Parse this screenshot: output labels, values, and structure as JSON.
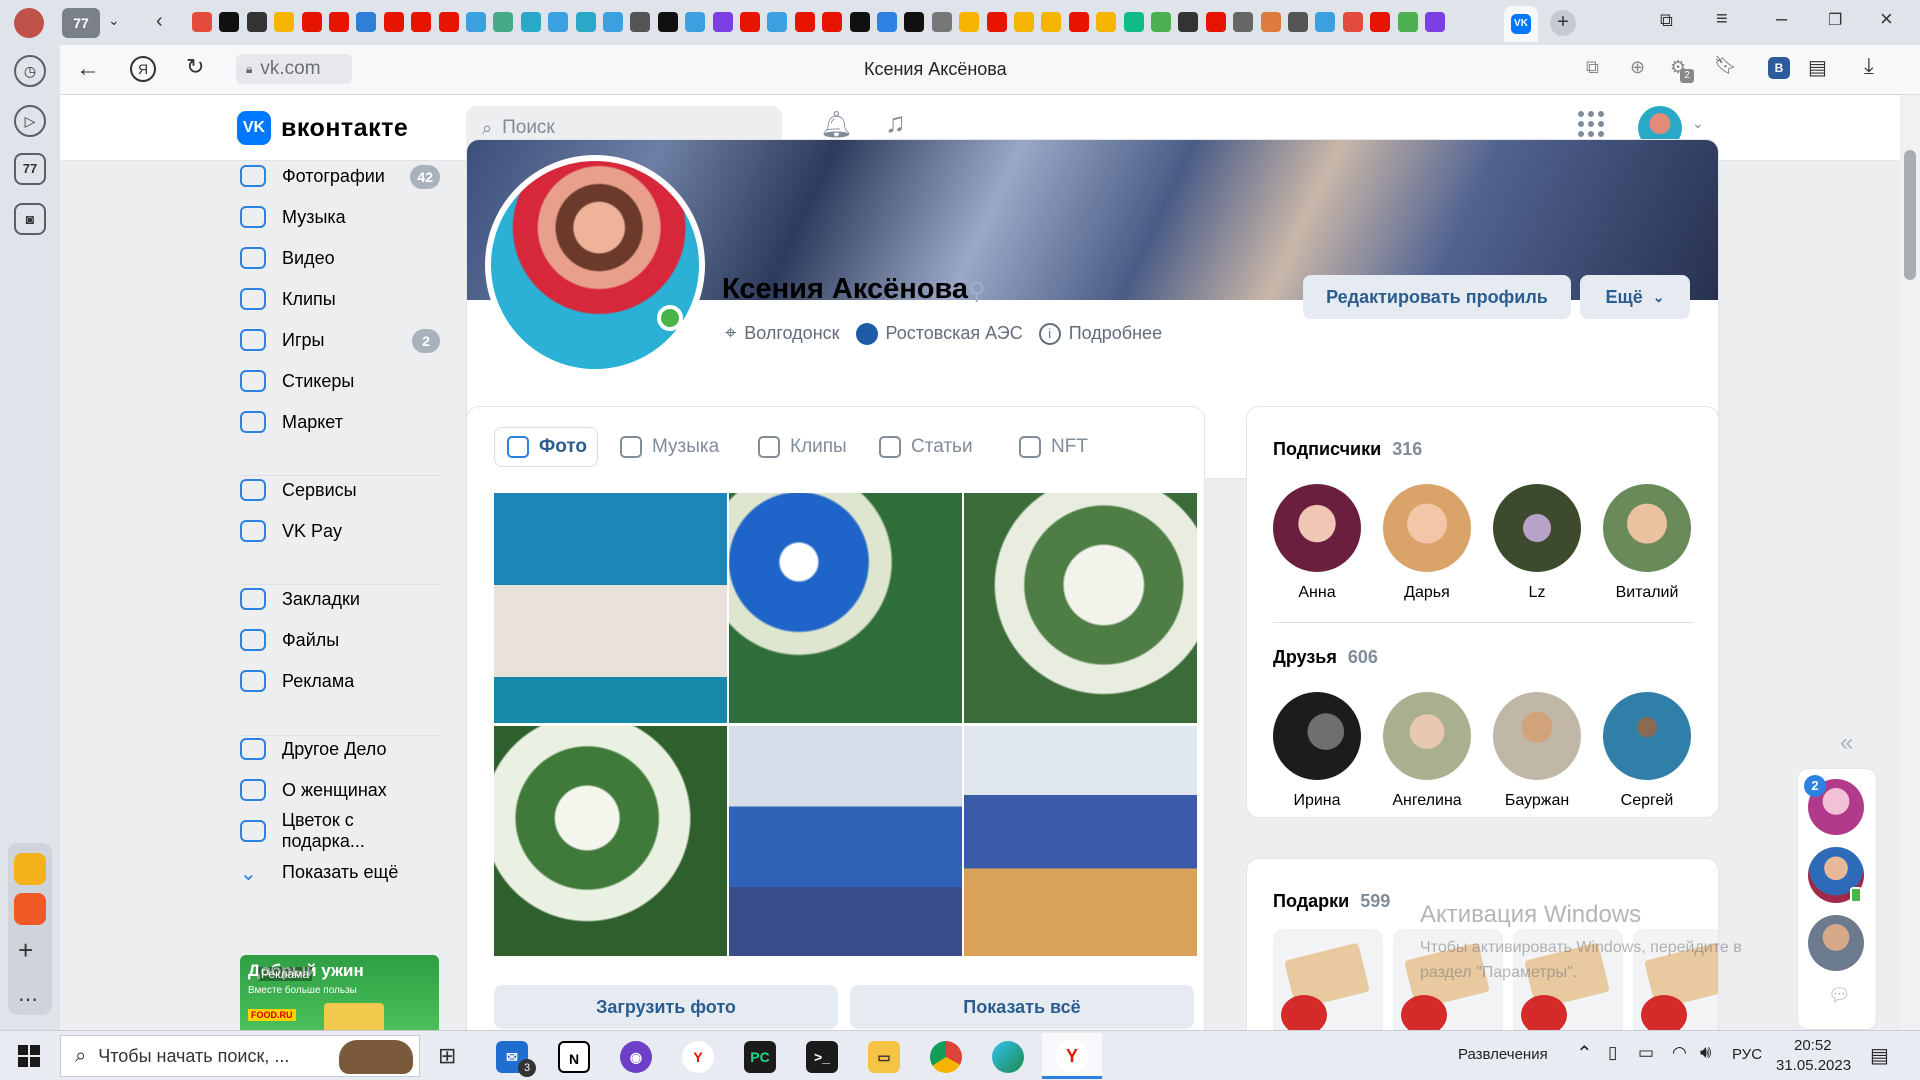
{
  "browser": {
    "tab_counter": "77",
    "tab_count_badge": "77",
    "url": "vk.com",
    "page_title": "Ксения Аксёнова",
    "extension_badge": "2"
  },
  "vk": {
    "logo_text": "вконтакте",
    "search_placeholder": "Поиск",
    "sidebar": [
      {
        "label": "Фотографии",
        "count": "42"
      },
      {
        "label": "Музыка",
        "count": ""
      },
      {
        "label": "Видео",
        "count": ""
      },
      {
        "label": "Клипы",
        "count": ""
      },
      {
        "label": "Игры",
        "count": "2"
      },
      {
        "label": "Стикеры",
        "count": ""
      },
      {
        "label": "Маркет",
        "count": ""
      },
      {
        "label": "Сервисы",
        "count": ""
      },
      {
        "label": "VK Pay",
        "count": ""
      },
      {
        "label": "Закладки",
        "count": ""
      },
      {
        "label": "Файлы",
        "count": ""
      },
      {
        "label": "Реклама",
        "count": ""
      },
      {
        "label": "Другое Дело",
        "count": ""
      },
      {
        "label": "О женщинах",
        "count": ""
      },
      {
        "label": "Цветок с подарка...",
        "count": ""
      },
      {
        "label": "Показать ещё",
        "count": ""
      }
    ],
    "ad_title": "Добрый ужин",
    "ad_subtitle": "Вместе больше пользы",
    "ad_brand": "FOOD.RU",
    "ad_label": "Реклама",
    "profile": {
      "name": "Ксения Аксёнова",
      "city": "Волгодонск",
      "work": "Ростовская АЭС",
      "more": "Подробнее",
      "edit_button": "Редактировать профиль",
      "more_button": "Ещё"
    },
    "media_tabs": [
      "Фото",
      "Музыка",
      "Клипы",
      "Статьи",
      "NFT"
    ],
    "upload_button": "Загрузить фото",
    "show_all_button": "Показать всё",
    "subscribers": {
      "label": "Подписчики",
      "count": "316",
      "people": [
        "Анна",
        "Дарья",
        "Lz",
        "Виталий"
      ]
    },
    "friends": {
      "label": "Друзья",
      "count": "606",
      "people": [
        "Ирина",
        "Ангелина",
        "Бауржан",
        "Сергей"
      ]
    },
    "gifts": {
      "label": "Подарки",
      "count": "599"
    },
    "watermark_title": "Активация Windows",
    "watermark_text": "Чтобы активировать Windows, перейдите в раздел \"Параметры\"."
  },
  "right_panel": {
    "chat_badge": "2"
  },
  "taskbar": {
    "search_placeholder": "Чтобы начать поиск, ...",
    "mail_badge": "3",
    "tray_label": "Развлечения",
    "lang": "РУС",
    "time": "20:52",
    "date": "31.05.2023"
  },
  "colors": {
    "vk_blue": "#0077ff",
    "accent": "#2d81e0",
    "online": "#4bb34b"
  }
}
